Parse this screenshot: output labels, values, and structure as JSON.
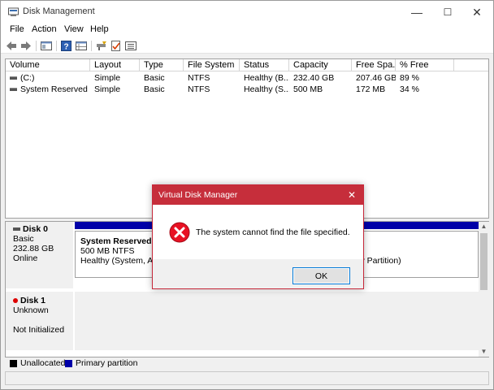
{
  "window": {
    "title": "Disk Management",
    "controls": {
      "minimize": "—",
      "maximize": "☐",
      "close": "✕"
    }
  },
  "menu": [
    "File",
    "Action",
    "View",
    "Help"
  ],
  "toolbar": {
    "icons": [
      "back-arrow-icon",
      "forward-arrow-icon",
      "console-tree-icon",
      "help-icon",
      "properties-grid-icon",
      "connect-icon",
      "checklist-icon",
      "details-icon"
    ]
  },
  "volume_table": {
    "columns": [
      "Volume",
      "Layout",
      "Type",
      "File System",
      "Status",
      "Capacity",
      "Free Spa...",
      "% Free"
    ],
    "rows": [
      [
        "(C:)",
        "Simple",
        "Basic",
        "NTFS",
        "Healthy (B...",
        "232.40 GB",
        "207.46 GB",
        "89 %"
      ],
      [
        "System Reserved",
        "Simple",
        "Basic",
        "NTFS",
        "Healthy (S...",
        "500 MB",
        "172 MB",
        "34 %"
      ]
    ]
  },
  "disks": [
    {
      "name": "Disk 0",
      "type": "Basic",
      "size": "232.88 GB",
      "status": "Online",
      "partitions": [
        {
          "name": "System Reserved",
          "detail": "500 MB NTFS",
          "status": "Healthy (System, Acti"
        },
        {
          "status": "ry Partition)"
        }
      ]
    },
    {
      "name": "Disk 1",
      "type": "Unknown",
      "status": "Not Initialized"
    }
  ],
  "legend": [
    {
      "label": "Unallocated",
      "color": "#000000"
    },
    {
      "label": "Primary partition",
      "color": "#0000a8"
    }
  ],
  "dialog": {
    "title": "Virtual Disk Manager",
    "message": "The system cannot find the file specified.",
    "ok_label": "OK",
    "close": "✕"
  },
  "colors": {
    "dialog_accent": "#c62e3b",
    "primary_partition": "#0000a8",
    "error_icon": "#e81123"
  }
}
